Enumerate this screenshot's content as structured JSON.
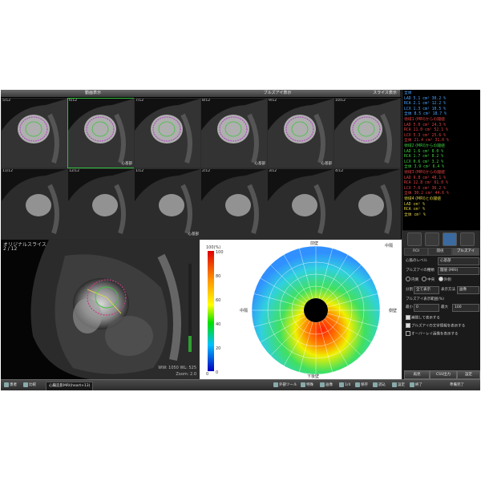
{
  "header": {
    "left_title": "動画表示",
    "center_title": "ブルズアイ表示",
    "right_title": "スライス表示"
  },
  "thumbnails": [
    {
      "label": "5/12",
      "tag": "",
      "selected": false
    },
    {
      "label": "6/12",
      "tag": "心基部",
      "selected": true
    },
    {
      "label": "7/12",
      "tag": "",
      "selected": false
    },
    {
      "label": "8/12",
      "tag": "心基部",
      "selected": false
    },
    {
      "label": "9/12",
      "tag": "心基部",
      "selected": false
    },
    {
      "label": "10/12",
      "tag": "",
      "selected": false
    },
    {
      "label": "11/12",
      "tag": "",
      "selected": false
    },
    {
      "label": "12/12",
      "tag": "",
      "selected": false
    },
    {
      "label": "1/12",
      "tag": "心基部",
      "selected": false
    },
    {
      "label": "2/12",
      "tag": "",
      "selected": false
    },
    {
      "label": "3/12",
      "tag": "",
      "selected": false
    },
    {
      "label": "4/12",
      "tag": "",
      "selected": false
    }
  ],
  "cine": {
    "title": "オリジナルスライス",
    "slice": "2 / 12",
    "wl": "WW: 1050  WL: 525",
    "zoom": "Zoom: 2.0"
  },
  "bullseye": {
    "top_label": "前壁",
    "bottom_label": "下後壁",
    "right_top_label": "中隔",
    "right_label": "側壁",
    "left_label": "中隔",
    "scale_max": "100(%)",
    "scale_min": "0",
    "scale_ticks": [
      "100",
      "80",
      "60",
      "40",
      "20",
      "0"
    ]
  },
  "metrics": {
    "sections": [
      {
        "title": "全体",
        "color": "#4aa3ff",
        "rows": [
          {
            "name": "LAD",
            "val": "5.1",
            "unit": "cm²",
            "pct": "30.2",
            "color": "#4aa3ff"
          },
          {
            "name": "RCA",
            "val": "2.1",
            "unit": "cm²",
            "pct": "12.2",
            "color": "#4aa3ff"
          },
          {
            "name": "LCX",
            "val": "1.3",
            "unit": "cm²",
            "pct": "10.5",
            "color": "#4aa3ff"
          },
          {
            "name": "全体",
            "val": "8.5",
            "unit": "cm²",
            "pct": "18.7",
            "color": "#4aa3ff"
          }
        ]
      },
      {
        "title": "領域1 (MRI)からの閾値",
        "color": "#e04040",
        "rows": [
          {
            "name": "LAD",
            "val": "5.0",
            "unit": "cm²",
            "pct": "24.3",
            "color": "#e04040"
          },
          {
            "name": "RCA",
            "val": "11.0",
            "unit": "cm²",
            "pct": "52.1",
            "color": "#e04040"
          },
          {
            "name": "LCX",
            "val": "5.3",
            "unit": "cm²",
            "pct": "25.6",
            "color": "#e04040"
          },
          {
            "name": "全体",
            "val": "21.4",
            "unit": "cm²",
            "pct": "31.0",
            "color": "#e04040"
          }
        ]
      },
      {
        "title": "領域2 (MRI)からの閾値",
        "color": "#40d040",
        "rows": [
          {
            "name": "LAD",
            "val": "1.6",
            "unit": "cm²",
            "pct": "8.0",
            "color": "#40d040"
          },
          {
            "name": "RCA",
            "val": "1.7",
            "unit": "cm²",
            "pct": "8.2",
            "color": "#40d040"
          },
          {
            "name": "LCX",
            "val": "0.6",
            "unit": "cm²",
            "pct": "3.2",
            "color": "#40d040"
          },
          {
            "name": "全体",
            "val": "3.9",
            "unit": "cm²",
            "pct": "6.4",
            "color": "#40d040"
          }
        ]
      },
      {
        "title": "領域3 (MRI)からの閾値",
        "color": "#e04040",
        "rows": [
          {
            "name": "LAD",
            "val": "9.8",
            "unit": "cm²",
            "pct": "48.1",
            "color": "#e04040"
          },
          {
            "name": "RCA",
            "val": "12.8",
            "unit": "cm²",
            "pct": "61.0",
            "color": "#e04040"
          },
          {
            "name": "LCX",
            "val": "7.6",
            "unit": "cm²",
            "pct": "36.2",
            "color": "#e04040"
          },
          {
            "name": "全体",
            "val": "30.2",
            "unit": "cm²",
            "pct": "44.6",
            "color": "#e04040"
          }
        ]
      },
      {
        "title": "領域4 (MRI)との閾値",
        "color": "#e0d040",
        "rows": [
          {
            "name": "LAD",
            "val": "",
            "unit": "cm²",
            "pct": "",
            "color": "#e0d040"
          },
          {
            "name": "RCA",
            "val": "",
            "unit": "cm²",
            "pct": "",
            "color": "#e0d040"
          },
          {
            "name": "全体",
            "val": "",
            "unit": "cm²",
            "pct": "",
            "color": "#e0d040"
          }
        ]
      }
    ]
  },
  "panel": {
    "tab_roi": "ROI",
    "tab_threshold": "閾値",
    "tab_bullseye": "ブルズアイ",
    "level_label": "心筋のレベル",
    "level_value": "心基部",
    "type_label": "ブルズアイの種類",
    "type_value": "閾値 (%)",
    "type_option2": "閾値 (MRI)",
    "radio_label": "",
    "radio_options": [
      "内側",
      "中央",
      "外側"
    ],
    "radio_selected": 2,
    "split_label": "分割",
    "split_value": "全て表示",
    "display_label": "表示方法",
    "display_value": "画像",
    "range_label": "ブルズアイ表示範囲(%)",
    "range_min_label": "最小",
    "range_min_value": "0",
    "range_max_label": "最大",
    "range_max_value": "100",
    "check_items": [
      {
        "label": "補間して表示する",
        "checked": true
      },
      {
        "label": "ブルズアイの文字情報を表示する",
        "checked": true
      },
      {
        "label": "オーバーレイ画像を表示する",
        "checked": false
      }
    ],
    "btn_reset": "再見",
    "btn_csv": "CSV出力",
    "btn_settings": "設定"
  },
  "taskbar": {
    "item1": "患者",
    "item2": "比較",
    "tab_text": "心臓造影MRI(heart+13)",
    "item3": "外部ツール",
    "item4": "特殊",
    "item5": "画像",
    "item6": "1/4",
    "item7": "保存",
    "item8": "読込",
    "item9": "設定",
    "item10": "終了",
    "status": "準備完了"
  }
}
